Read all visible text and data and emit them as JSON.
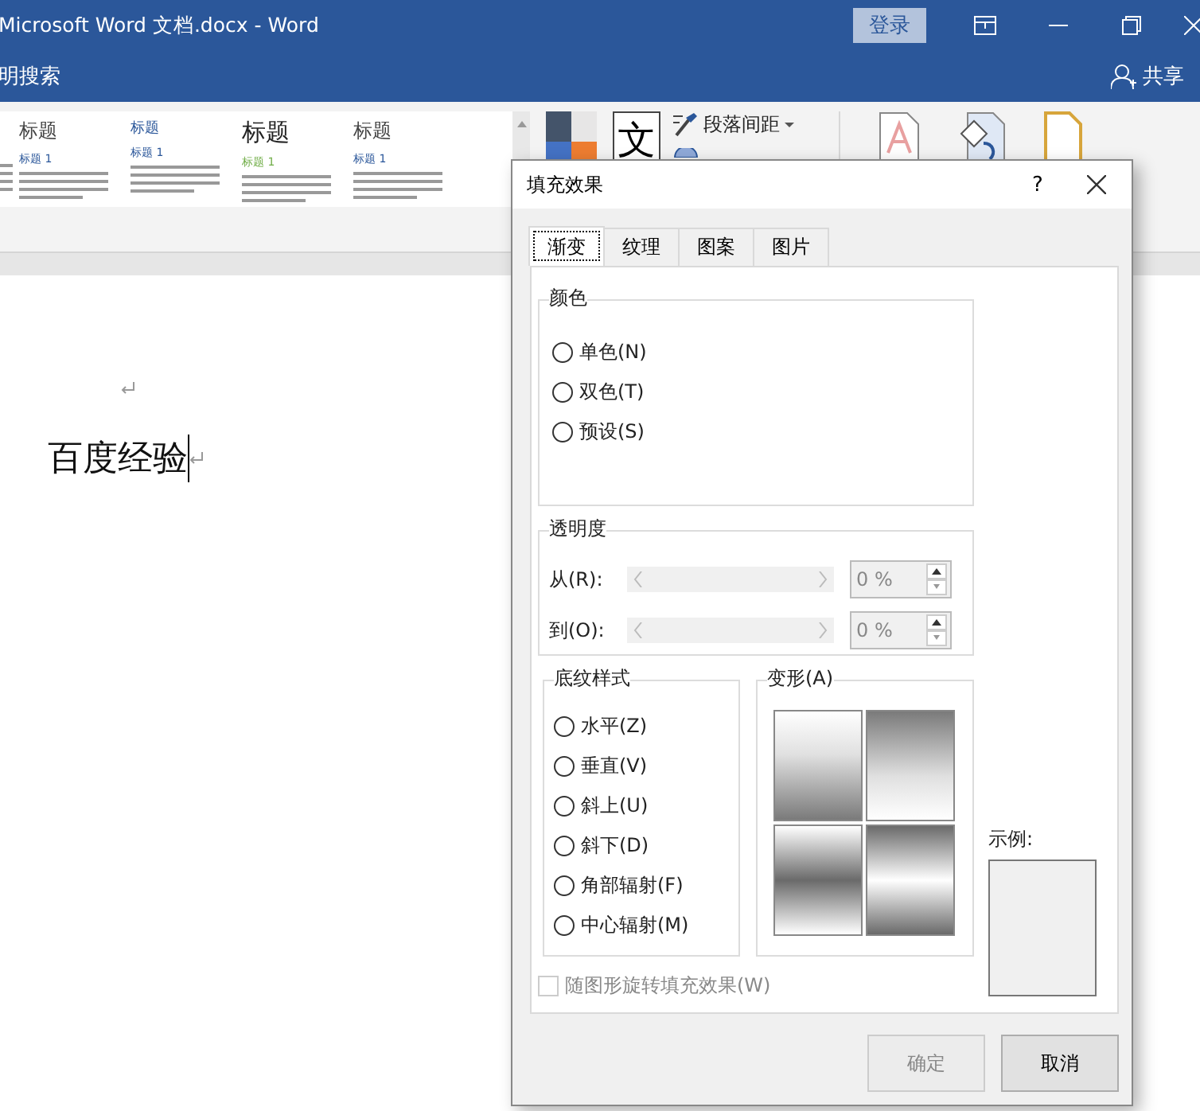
{
  "window": {
    "title": "Microsoft Word 文档.docx  -  Word",
    "sign_in": "登录",
    "share": "共享"
  },
  "tell_me": "明搜索",
  "ribbon": {
    "styles": [
      {
        "kind": "cut"
      },
      {
        "kind": "standard",
        "heading": "标题",
        "subheading": "标题 1"
      },
      {
        "kind": "blue",
        "heading": "标题",
        "subheading": "标题 1"
      },
      {
        "kind": "large",
        "heading": "标题",
        "subheading": "标题 1"
      },
      {
        "kind": "standard",
        "heading": "标题",
        "subheading": "标题 1"
      }
    ],
    "theme_glyph": "文",
    "paragraph_spacing": "段落间距"
  },
  "document": {
    "paragraphs": [
      {
        "kind": "empty"
      },
      {
        "kind": "text",
        "text": "百度经验"
      }
    ]
  },
  "dialog": {
    "title": "填充效果",
    "help": "?",
    "tabs": [
      {
        "label": "渐变",
        "selected": true
      },
      {
        "label": "纹理",
        "selected": false
      },
      {
        "label": "图案",
        "selected": false
      },
      {
        "label": "图片",
        "selected": false
      }
    ],
    "color_group": {
      "title": "颜色",
      "options": [
        {
          "label": "单色(N)",
          "selected": false
        },
        {
          "label": "双色(T)",
          "selected": false
        },
        {
          "label": "预设(S)",
          "selected": false
        }
      ]
    },
    "transparency": {
      "title": "透明度",
      "rows": [
        {
          "label": "从(R):",
          "value": "0 %",
          "disabled": true
        },
        {
          "label": "到(O):",
          "value": "0 %",
          "disabled": true
        }
      ]
    },
    "shading": {
      "title": "底纹样式",
      "options": [
        {
          "label": "水平(Z)",
          "selected": false
        },
        {
          "label": "垂直(V)",
          "selected": false
        },
        {
          "label": "斜上(U)",
          "selected": false
        },
        {
          "label": "斜下(D)",
          "selected": false
        },
        {
          "label": "角部辐射(F)",
          "selected": false
        },
        {
          "label": "中心辐射(M)",
          "selected": false
        }
      ]
    },
    "variants": {
      "title": "变形(A)"
    },
    "sample_label": "示例:",
    "rotate": {
      "label": "随图形旋转填充效果(W)",
      "checked": false,
      "disabled": true
    },
    "buttons": [
      {
        "label": "确定",
        "disabled": true
      },
      {
        "label": "取消",
        "disabled": false
      }
    ]
  }
}
